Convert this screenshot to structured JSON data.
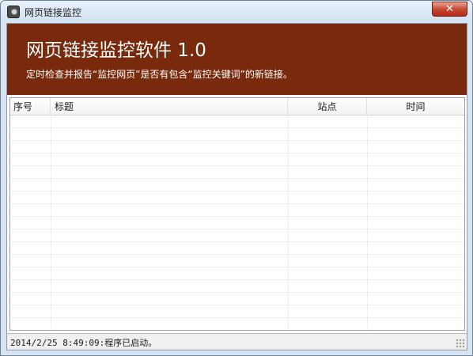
{
  "window": {
    "title": "网页链接监控",
    "close_glyph": "✕"
  },
  "banner": {
    "title": "网页链接监控软件 1.0",
    "subtitle": "定时检查并报告“监控网页”是否有包含“监控关键词”的新链接。",
    "background_color": "#7a2a0c"
  },
  "table": {
    "columns": [
      "序号",
      "标题",
      "站点",
      "时间"
    ],
    "rows": []
  },
  "status": {
    "text": "2014/2/25 8:49:09:程序已启动。"
  }
}
